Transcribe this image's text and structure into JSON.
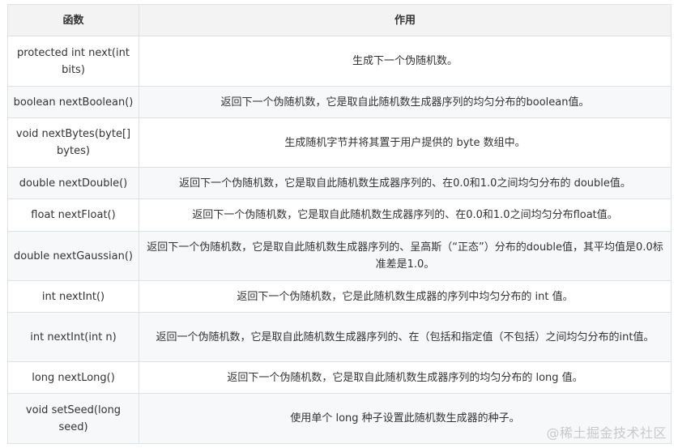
{
  "table": {
    "headers": [
      "函数",
      "作用"
    ],
    "rows": [
      {
        "func": "protected int next(int bits)",
        "desc": "生成下一个伪随机数。"
      },
      {
        "func": "boolean nextBoolean()",
        "desc": "返回下一个伪随机数，它是取自此随机数生成器序列的均匀分布的boolean值。"
      },
      {
        "func": "void nextBytes(byte[] bytes)",
        "desc": "生成随机字节并将其置于用户提供的 byte 数组中。"
      },
      {
        "func": "double nextDouble()",
        "desc": "返回下一个伪随机数，它是取自此随机数生成器序列的、在0.0和1.0之间均匀分布的 double值。"
      },
      {
        "func": "float nextFloat()",
        "desc": "返回下一个伪随机数，它是取自此随机数生成器序列的、在0.0和1.0之间均匀分布float值。"
      },
      {
        "func": "double nextGaussian()",
        "desc": "返回下一个伪随机数，它是取自此随机数生成器序列的、呈高斯（“正态”）分布的double值，其平均值是0.0标准差是1.0。"
      },
      {
        "func": "int nextInt()",
        "desc": "返回下一个伪随机数，它是此随机数生成器的序列中均匀分布的 int 值。"
      },
      {
        "func": "int nextInt(int n)",
        "desc": "返回一个伪随机数，它是取自此随机数生成器序列的、在（包括和指定值（不包括）之间均匀分布的int值。"
      },
      {
        "func": "long nextLong()",
        "desc": "返回下一个伪随机数，它是取自此随机数生成器序列的均匀分布的 long 值。"
      },
      {
        "func": "void setSeed(long seed)",
        "desc": "使用单个 long 种子设置此随机数生成器的种子。"
      }
    ]
  },
  "watermark": "@稀土掘金技术社区"
}
